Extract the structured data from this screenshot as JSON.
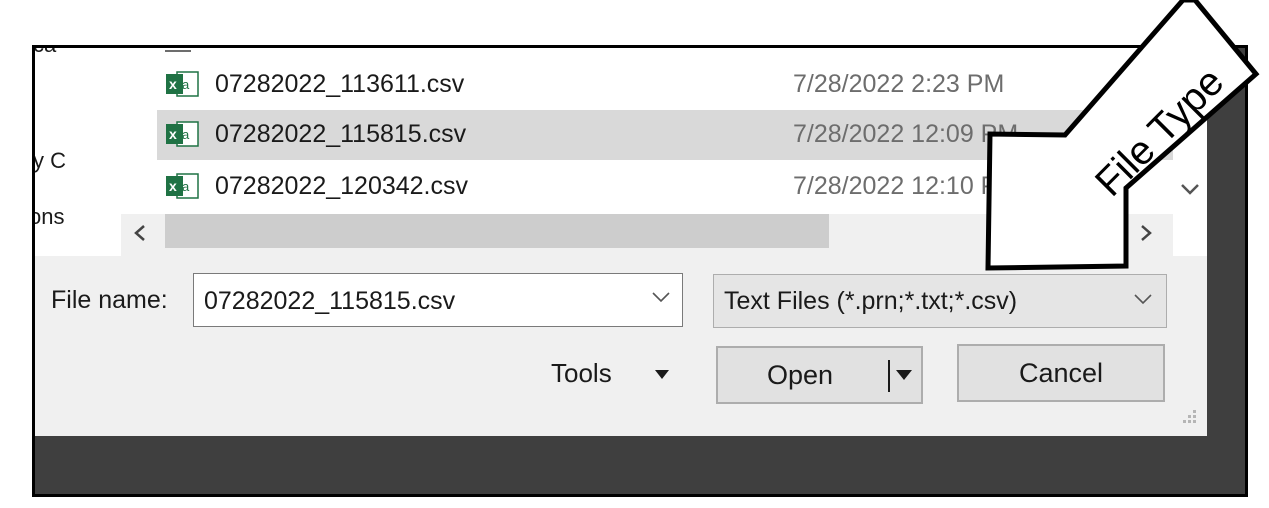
{
  "file_list": {
    "rows": [
      {
        "name": "07282022_113611.csv",
        "date": "7/28/2022 2:23 PM",
        "selected": false
      },
      {
        "name": "07282022_115815.csv",
        "date": "7/28/2022 12:09 PM",
        "selected": true
      },
      {
        "name": "07282022_120342.csv",
        "date": "7/28/2022 12:10 PM",
        "selected": false
      }
    ],
    "icon": "excel-csv-icon"
  },
  "nav_pane": {
    "partial_texts": [
      "y C",
      "ons"
    ]
  },
  "footer": {
    "file_name_label": "File name:",
    "file_name_value": "07282022_115815.csv",
    "file_type_value": "Text Files (*.prn;*.txt;*.csv)",
    "tools_label": "Tools",
    "open_label": "Open",
    "cancel_label": "Cancel"
  },
  "annotation": {
    "label": "File Type"
  },
  "colors": {
    "selection": "#d9d9d9",
    "excel_green": "#1f7244",
    "dialog_bg": "#f0f0f0",
    "window_shadow": "#3f3f3f"
  }
}
